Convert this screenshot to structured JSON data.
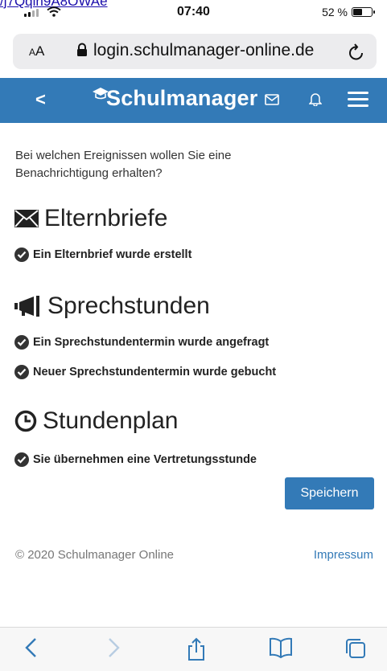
{
  "top_link": {
    "text": "/j7Qqin9A8OWAe"
  },
  "status_bar": {
    "time": "07:40",
    "battery": "52 %",
    "battery_level": 0.52
  },
  "url_bar": {
    "text_size": "AA",
    "url": "login.schulmanager-online.de"
  },
  "app_nav": {
    "back": "<",
    "logo": "Schulmanager"
  },
  "intro": "Bei welchen Ereignissen wollen Sie eine Benachrichtigung erhalten?",
  "sections": [
    {
      "title": "Elternbriefe",
      "icon": "envelope-icon",
      "items": [
        "Ein Elternbrief wurde erstellt"
      ]
    },
    {
      "title": "Sprechstunden",
      "icon": "megaphone-icon",
      "items": [
        "Ein Sprechstundentermin wurde angefragt",
        "Neuer Sprechstundentermin wurde gebucht"
      ]
    },
    {
      "title": "Stundenplan",
      "icon": "clock-icon",
      "items": [
        "Sie übernehmen eine Vertretungsstunde"
      ]
    }
  ],
  "save_label": "Speichern",
  "footer": {
    "copyright": "© 2020 Schulmanager Online",
    "imprint": "Impressum"
  },
  "colors": {
    "brand": "#337ab7",
    "checkbox": "#333333"
  }
}
